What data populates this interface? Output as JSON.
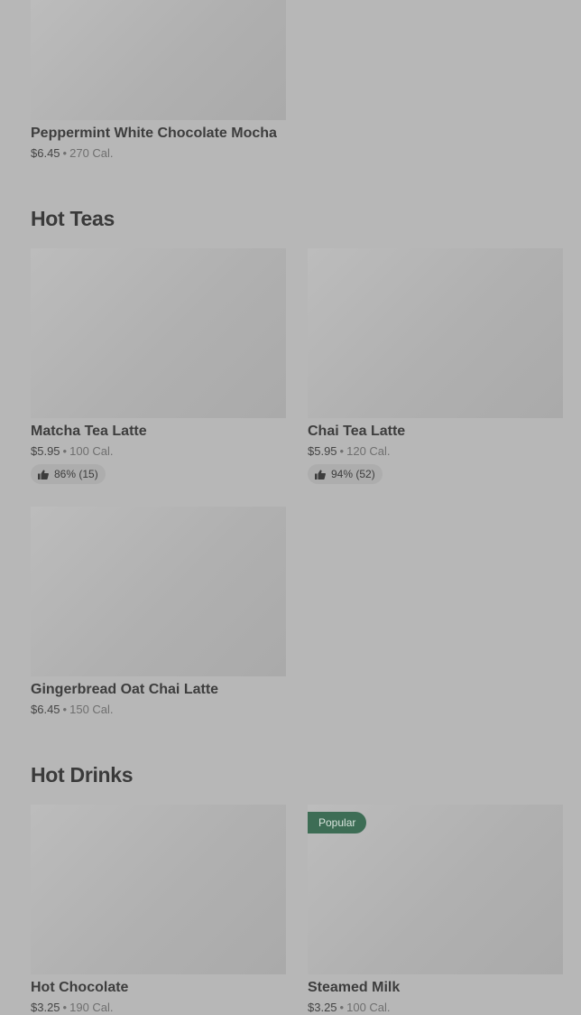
{
  "top_item": {
    "name": "Peppermint White Chocolate Mocha",
    "price": "$6.45",
    "separator": "•",
    "calories": "270 Cal."
  },
  "sections": [
    {
      "title": "Hot Teas",
      "items": [
        {
          "name": "Matcha Tea Latte",
          "price": "$5.95",
          "separator": "•",
          "calories": "100 Cal.",
          "rating": "86% (15)"
        },
        {
          "name": "Chai Tea Latte",
          "price": "$5.95",
          "separator": "•",
          "calories": "120 Cal.",
          "rating": "94% (52)"
        },
        {
          "name": "Gingerbread Oat Chai Latte",
          "price": "$6.45",
          "separator": "•",
          "calories": "150 Cal."
        }
      ]
    },
    {
      "title": "Hot Drinks",
      "items": [
        {
          "name": "Hot Chocolate",
          "price": "$3.25",
          "separator": "•",
          "calories": "190 Cal."
        },
        {
          "name": "Steamed Milk",
          "price": "$3.25",
          "separator": "•",
          "calories": "100 Cal.",
          "badge": "Popular"
        }
      ]
    }
  ],
  "icons": {
    "rating": "thumbs-up-icon"
  },
  "colors": {
    "page_background": "#b7b7b7",
    "popular_badge": "#3d6d55"
  }
}
